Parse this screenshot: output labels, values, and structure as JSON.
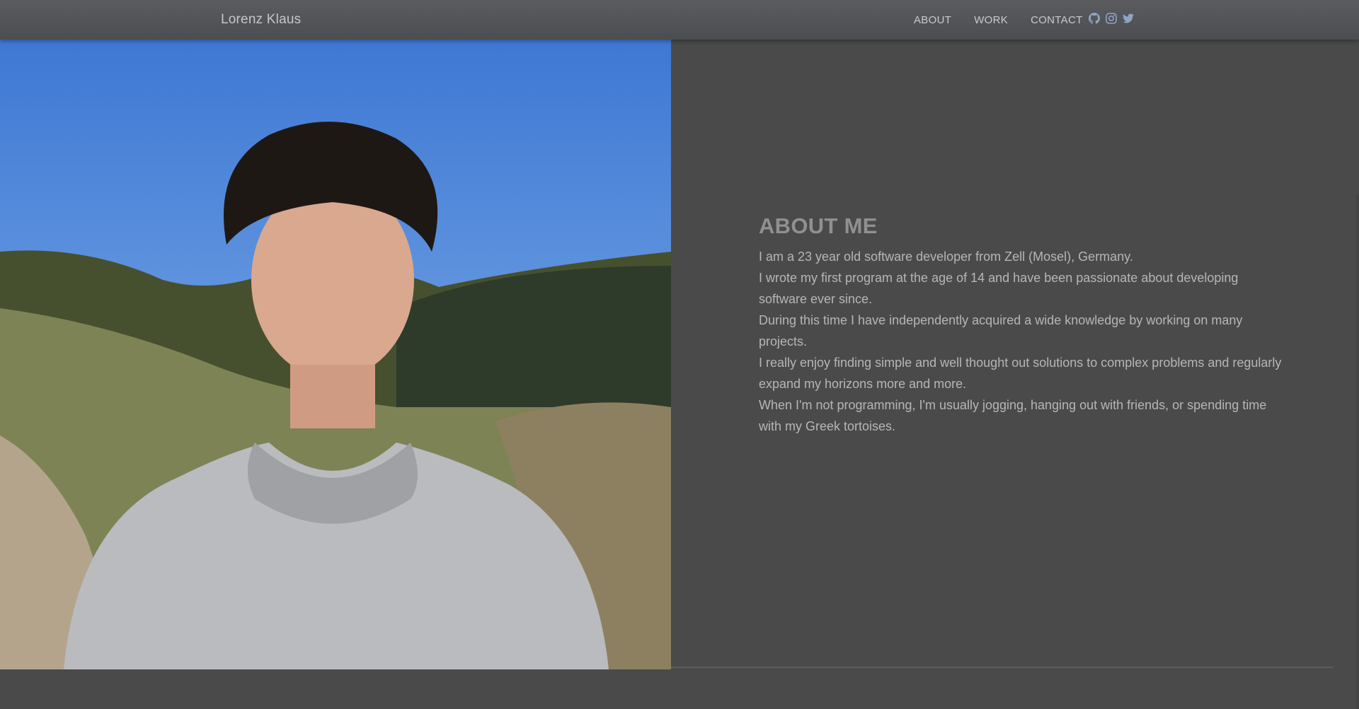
{
  "navbar": {
    "brand": "Lorenz Klaus",
    "links": [
      {
        "label": "ABOUT"
      },
      {
        "label": "WORK"
      },
      {
        "label": "CONTACT"
      }
    ],
    "social": [
      {
        "icon": "github-icon"
      },
      {
        "icon": "instagram-icon"
      },
      {
        "icon": "twitter-icon"
      }
    ]
  },
  "hero": {
    "image_alt_icon": "portrait-photo"
  },
  "about": {
    "title": "ABOUT ME",
    "paragraphs": [
      "I am a 23 year old software developer from Zell (Mosel), Germany.",
      "I wrote my first program at the age of 14 and have been passionate about developing software ever since.",
      "During this time I have independently acquired a wide knowledge by working on many projects.",
      "I really enjoy finding simple and well thought out solutions to complex problems and regularly expand my horizons more and more.",
      "When I'm not programming, I'm usually jogging, hanging out with friends, or spending time with my Greek tortoises."
    ]
  },
  "colors": {
    "background": "#4a4a4a",
    "navbar": "#55575b",
    "title": "#8e9092",
    "text": "#b4b6b8"
  }
}
